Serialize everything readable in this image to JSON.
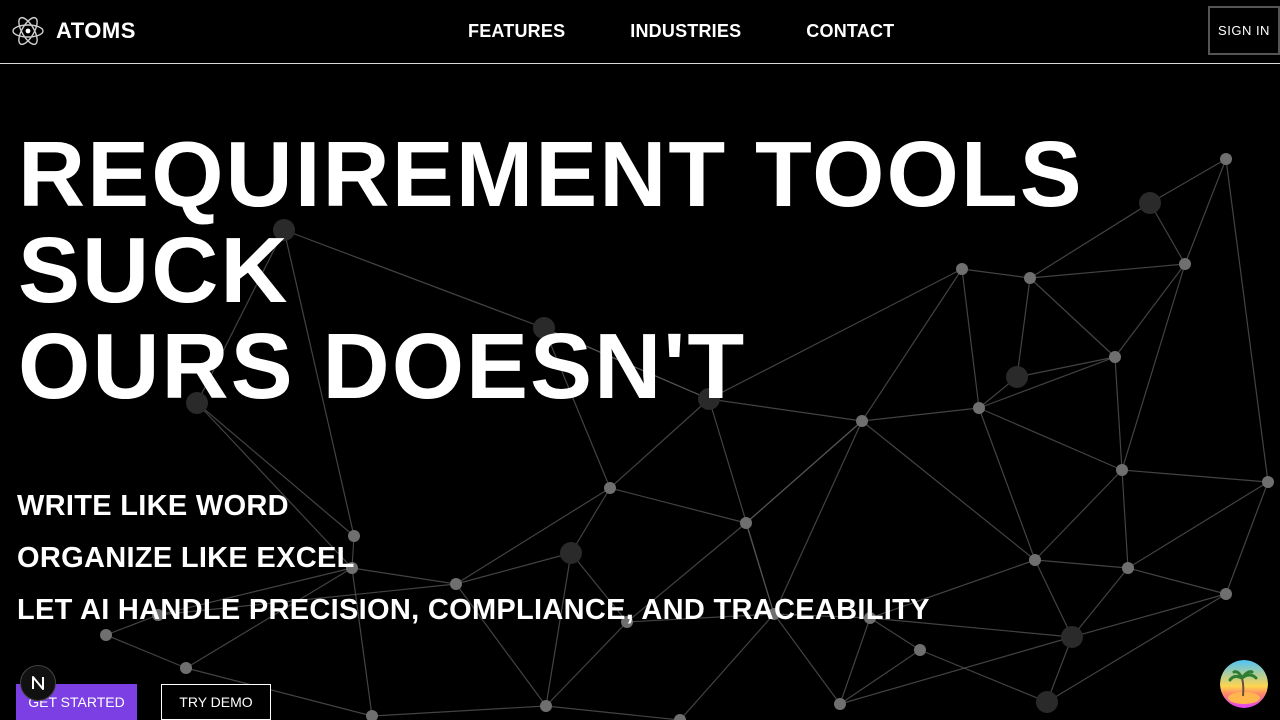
{
  "brand": {
    "name": "ATOMS"
  },
  "nav": {
    "links": [
      "FEATURES",
      "INDUSTRIES",
      "CONTACT"
    ],
    "sign_in": "SIGN IN"
  },
  "hero": {
    "headline_lines": [
      "REQUIREMENT TOOLS",
      "SUCK",
      "OURS DOESN'T"
    ],
    "taglines": [
      "WRITE LIKE WORD",
      "ORGANIZE LIKE EXCEL",
      "LET AI HANDLE PRECISION, COMPLIANCE, AND TRACEABILITY"
    ],
    "primary_cta": "GET STARTED",
    "secondary_cta": "TRY DEMO"
  },
  "widgets": {
    "dev_badge_letter": "N"
  },
  "colors": {
    "background": "#000000",
    "text": "#ffffff",
    "accent": "#7b3fe4",
    "network_line": "#5a5a5a",
    "network_node": "#6f6f6f"
  },
  "icons": [
    "atom-logo-icon",
    "avatar-icon"
  ]
}
